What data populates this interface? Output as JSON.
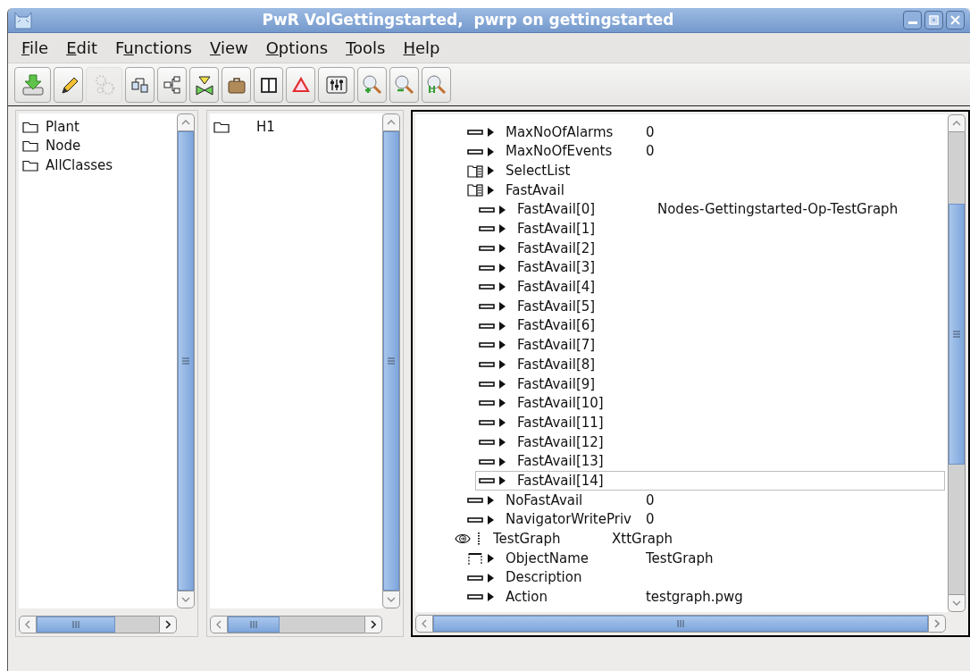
{
  "window": {
    "title": "PwR VolGettingstarted,  pwrp on gettingstarted"
  },
  "menu": [
    {
      "key": "F",
      "rest": "ile"
    },
    {
      "key": "E",
      "rest": "dit"
    },
    {
      "head": "F",
      "key": "u",
      "rest": "nctions"
    },
    {
      "key": "V",
      "rest": "iew"
    },
    {
      "key": "O",
      "rest": "ptions"
    },
    {
      "key": "T",
      "rest": "ools"
    },
    {
      "key": "H",
      "rest": "elp"
    }
  ],
  "toolbar": [
    {
      "kind": "save",
      "disabled": false
    },
    {
      "kind": "edit",
      "disabled": false
    },
    {
      "kind": "gears",
      "disabled": true
    },
    {
      "kind": "link",
      "disabled": false
    },
    {
      "kind": "hierarchy",
      "disabled": false
    },
    {
      "kind": "valve",
      "disabled": false
    },
    {
      "kind": "briefcase",
      "disabled": false
    },
    {
      "kind": "book",
      "disabled": false
    },
    {
      "kind": "alarm",
      "disabled": false
    },
    {
      "kind": "mixer",
      "disabled": false
    },
    {
      "kind": "zoom-in",
      "disabled": false
    },
    {
      "kind": "zoom-out",
      "disabled": false
    },
    {
      "kind": "zoom-reset",
      "disabled": false
    }
  ],
  "plant_pane": {
    "items": [
      {
        "label": "Plant",
        "selected": false
      },
      {
        "label": "Node",
        "selected": false
      },
      {
        "label": "AllClasses",
        "selected": false
      }
    ]
  },
  "node_pane": {
    "items": [
      {
        "label": "H1",
        "selected": false
      }
    ]
  },
  "attribute_pane": {
    "focused": true,
    "rows": [
      {
        "kind": "attribute",
        "name": "MaxNoOfAlarms",
        "value": "0",
        "selected": false
      },
      {
        "kind": "attribute",
        "name": "MaxNoOfEvents",
        "value": "0",
        "selected": false
      },
      {
        "kind": "array",
        "name": "SelectList",
        "selected": false
      },
      {
        "kind": "array",
        "name": "FastAvail",
        "selected": false,
        "children": [
          {
            "kind": "attribute",
            "name": "FastAvail[0]",
            "value": "Nodes-Gettingstarted-Op-TestGraph",
            "selected": false
          },
          {
            "kind": "attribute",
            "name": "FastAvail[1]",
            "selected": false
          },
          {
            "kind": "attribute",
            "name": "FastAvail[2]",
            "selected": false
          },
          {
            "kind": "attribute",
            "name": "FastAvail[3]",
            "selected": false
          },
          {
            "kind": "attribute",
            "name": "FastAvail[4]",
            "selected": false
          },
          {
            "kind": "attribute",
            "name": "FastAvail[5]",
            "selected": false
          },
          {
            "kind": "attribute",
            "name": "FastAvail[6]",
            "selected": false
          },
          {
            "kind": "attribute",
            "name": "FastAvail[7]",
            "selected": false
          },
          {
            "kind": "attribute",
            "name": "FastAvail[8]",
            "selected": false
          },
          {
            "kind": "attribute",
            "name": "FastAvail[9]",
            "selected": false
          },
          {
            "kind": "attribute",
            "name": "FastAvail[10]",
            "selected": false
          },
          {
            "kind": "attribute",
            "name": "FastAvail[11]",
            "selected": false
          },
          {
            "kind": "attribute",
            "name": "FastAvail[12]",
            "selected": false
          },
          {
            "kind": "attribute",
            "name": "FastAvail[13]",
            "selected": false
          },
          {
            "kind": "attribute",
            "name": "FastAvail[14]",
            "selected": true
          }
        ]
      },
      {
        "kind": "attribute",
        "name": "NoFastAvail",
        "value": "0",
        "selected": false
      },
      {
        "kind": "attribute",
        "name": "NavigatorWritePriv",
        "value": "0",
        "selected": false
      },
      {
        "kind": "object",
        "name": "TestGraph",
        "value": "XttGraph",
        "selected": false,
        "children": [
          {
            "kind": "objname",
            "name": "ObjectName",
            "value": "TestGraph",
            "selected": false
          },
          {
            "kind": "attribute",
            "name": "Description",
            "selected": false
          },
          {
            "kind": "attribute",
            "name": "Action",
            "value": "testgraph.pwg",
            "selected": false
          }
        ]
      }
    ]
  }
}
